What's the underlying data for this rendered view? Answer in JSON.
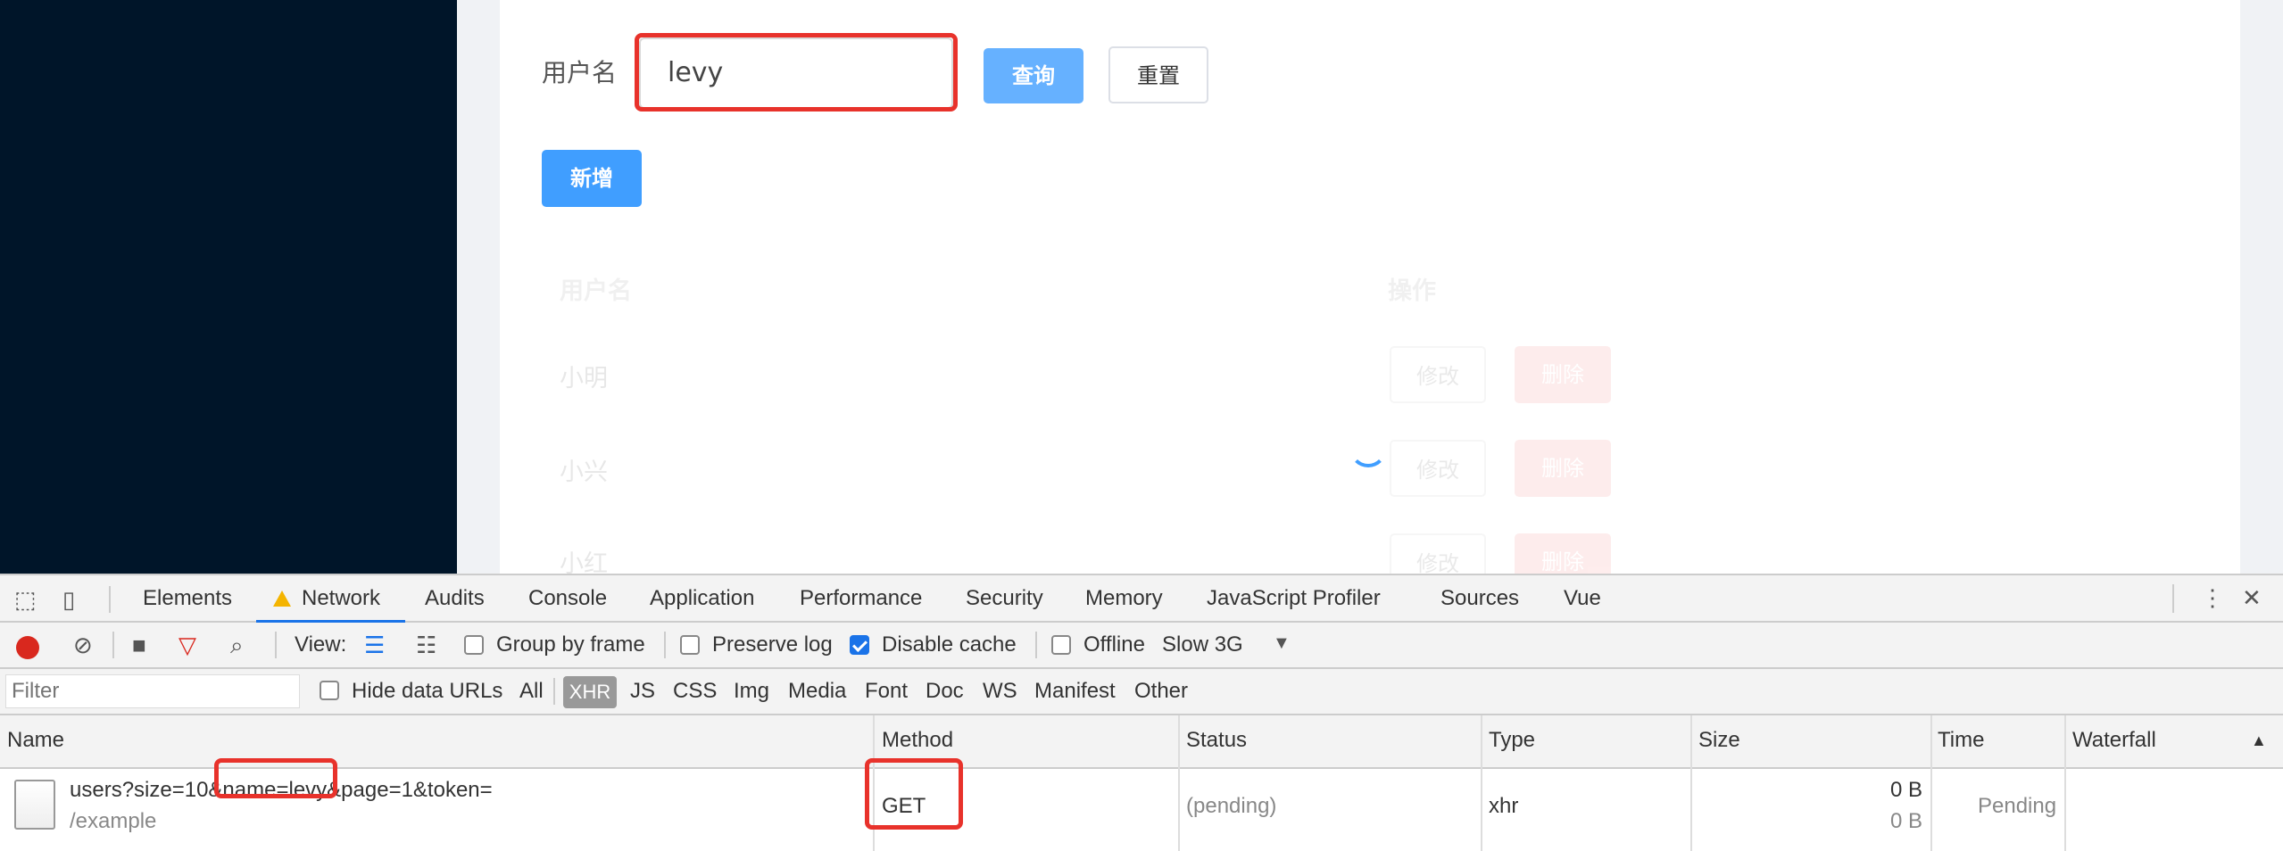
{
  "page": {
    "search_label": "用户名",
    "search_value": "levy",
    "query_button": "查询",
    "reset_button": "重置",
    "add_button": "新增",
    "table": {
      "headers": [
        "用户名",
        "操作"
      ],
      "rows": [
        {
          "name": "小明",
          "edit": "修改",
          "delete": "删除"
        },
        {
          "name": "小兴",
          "edit": "修改",
          "delete": "删除"
        },
        {
          "name": "小红",
          "edit": "修改",
          "delete": "删除"
        }
      ]
    }
  },
  "devtools": {
    "tabs": [
      "Elements",
      "Network",
      "Audits",
      "Console",
      "Application",
      "Performance",
      "Security",
      "Memory",
      "JavaScript Profiler",
      "Sources",
      "Vue"
    ],
    "active_tab": "Network",
    "toolbar": {
      "view_label": "View:",
      "group_by_frame": "Group by frame",
      "preserve_log": "Preserve log",
      "disable_cache": "Disable cache",
      "offline": "Offline",
      "throttle": "Slow 3G"
    },
    "filter": {
      "placeholder": "Filter",
      "hide_data_urls": "Hide data URLs",
      "types": [
        "All",
        "XHR",
        "JS",
        "CSS",
        "Img",
        "Media",
        "Font",
        "Doc",
        "WS",
        "Manifest",
        "Other"
      ]
    },
    "columns": [
      "Name",
      "Method",
      "Status",
      "Type",
      "Size",
      "Time",
      "Waterfall"
    ],
    "request": {
      "name": "users?size=10&name=levy&page=1&token=",
      "path": "/example",
      "method": "GET",
      "status": "(pending)",
      "type": "xhr",
      "size_1": "0 B",
      "size_2": "0 B",
      "time": "Pending"
    }
  },
  "colors": {
    "sidebar": "#001529",
    "primary": "#409eff",
    "annotation": "#e8322b"
  }
}
